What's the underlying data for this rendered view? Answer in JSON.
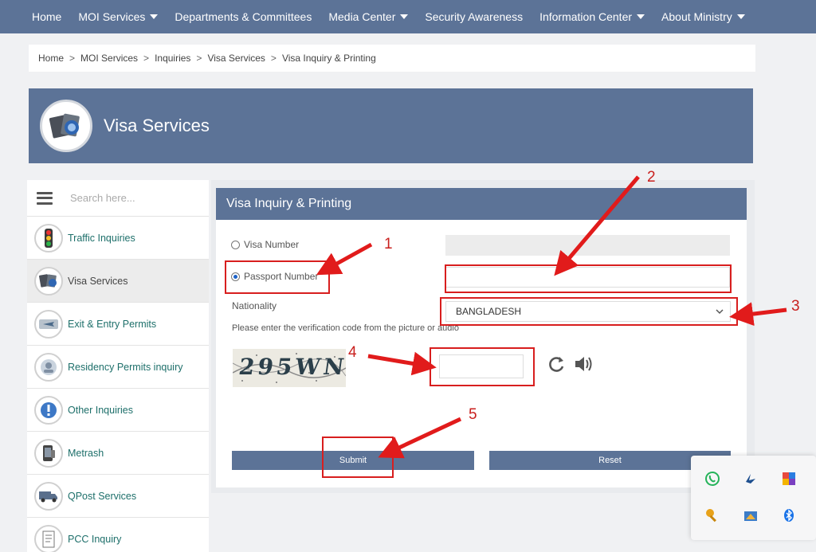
{
  "nav": {
    "items": [
      {
        "label": "Home",
        "caret": false
      },
      {
        "label": "MOI Services",
        "caret": true
      },
      {
        "label": "Departments & Committees",
        "caret": false
      },
      {
        "label": "Media Center",
        "caret": true
      },
      {
        "label": "Security Awareness",
        "caret": false
      },
      {
        "label": "Information Center",
        "caret": true
      },
      {
        "label": "About Ministry",
        "caret": true
      }
    ]
  },
  "breadcrumb": {
    "items": [
      "Home",
      "MOI Services",
      "Inquiries",
      "Visa Services",
      "Visa Inquiry & Printing"
    ],
    "separator": ">"
  },
  "banner": {
    "title": "Visa Services"
  },
  "sidebar": {
    "search_placeholder": "Search here...",
    "items": [
      {
        "label": "Traffic Inquiries",
        "icon": "traffic-light-icon"
      },
      {
        "label": "Visa Services",
        "icon": "passport-icon"
      },
      {
        "label": "Exit & Entry Permits",
        "icon": "airplane-icon"
      },
      {
        "label": "Residency Permits inquiry",
        "icon": "residency-card-icon"
      },
      {
        "label": "Other Inquiries",
        "icon": "exclamation-icon"
      },
      {
        "label": "Metrash",
        "icon": "phone-icon"
      },
      {
        "label": "QPost Services",
        "icon": "truck-icon"
      },
      {
        "label": "PCC Inquiry",
        "icon": "certificate-icon"
      }
    ]
  },
  "form": {
    "title": "Visa Inquiry & Printing",
    "visa_number_label": "Visa Number",
    "passport_number_label": "Passport Number",
    "selected": "passport",
    "visa_number_value": "",
    "passport_number_value": "",
    "nationality_label": "Nationality",
    "nationality_value": "BANGLADESH",
    "verification_text": "Please enter the verification code from the picture or audio",
    "captcha_text": "295WN",
    "captcha_input_value": "",
    "submit_label": "Submit",
    "reset_label": "Reset"
  },
  "annotations": [
    "1",
    "2",
    "3",
    "4",
    "5"
  ],
  "colors": {
    "brand": "#5c7397",
    "annotation_red": "#d81e1e",
    "link_teal": "#1d6f6a"
  }
}
